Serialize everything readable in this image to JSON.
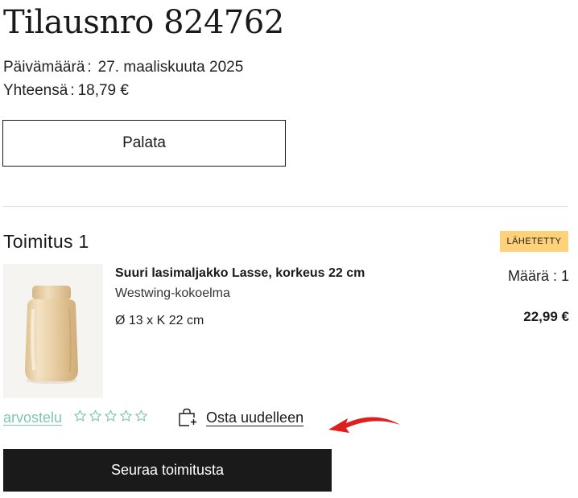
{
  "order": {
    "title": "Tilausnro 824762",
    "date_label": "Päivämäärä",
    "date_value": "27. maaliskuuta 2025",
    "total_label": "Yhteensä",
    "total_value": "18,79 €",
    "back_label": "Palata"
  },
  "shipment": {
    "title": "Toimitus 1",
    "status": "LÄHETETTY",
    "status_color": "#ffd27a"
  },
  "product": {
    "name": "Suuri lasimaljakko Lasse, korkeus 22 cm",
    "collection": "Westwing-kokoelma",
    "dimensions": "Ø 13 x K 22 cm",
    "quantity_label": "Määrä",
    "quantity_value": "1",
    "price": "22,99 €"
  },
  "actions": {
    "review_label": "arvostelu",
    "rating_stars": 5,
    "rating_value": 0,
    "buy_again_label": "Osta uudelleen",
    "track_label": "Seuraa toimitusta"
  },
  "icons": {
    "buy_again": "shopping-bag-plus-icon",
    "star": "star-outline-icon",
    "annotation": "red-arrow-icon"
  },
  "colors": {
    "accent_teal": "#7dc7b1",
    "annotation_red": "#e01e1e",
    "button_dark": "#1a1a1a"
  }
}
